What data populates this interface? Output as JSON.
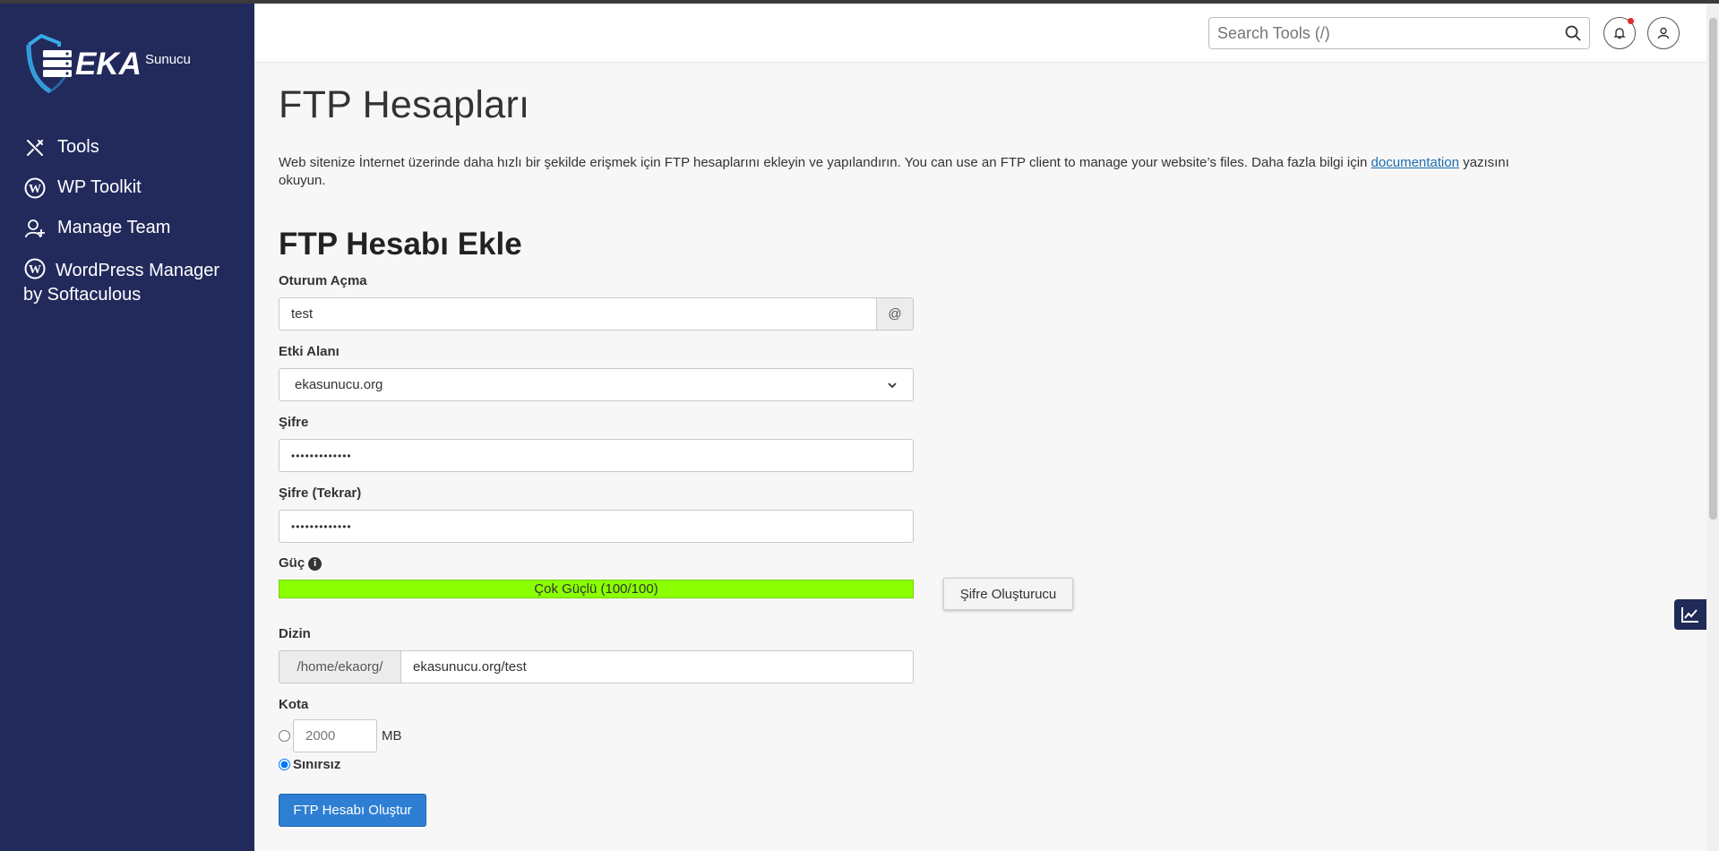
{
  "brand": {
    "name": "EKA",
    "suffix": "Sunucu"
  },
  "sidebar": {
    "items": [
      {
        "label": "Tools",
        "icon": "tools-icon"
      },
      {
        "label": "WP Toolkit",
        "icon": "wordpress-icon"
      },
      {
        "label": "Manage Team",
        "icon": "manage-team-icon"
      },
      {
        "label": "WordPress Manager by Softaculous",
        "icon": "wordpress-icon"
      }
    ]
  },
  "header": {
    "search_placeholder": "Search Tools (/)",
    "icons": [
      "search-icon",
      "bell-icon",
      "user-icon"
    ]
  },
  "main": {
    "title": "FTP Hesapları",
    "description": {
      "text": "Web sitenize İnternet üzerinde daha hızlı bir şekilde erişmek için FTP hesaplarını ekleyin ve yapılandırın. You can use an FTP client to manage your website’s files. Daha fazla bilgi için ",
      "link": "documentation",
      "text_after": " yazısını okuyun."
    },
    "section_title": "FTP Hesabı Ekle",
    "form": {
      "login_label": "Oturum Açma",
      "login_value": "test",
      "login_addon": "@",
      "domain_label": "Etki Alanı",
      "domain_value": "ekasunucu.org",
      "password_label": "Şifre",
      "password_value": "•••••••••••••",
      "password_repeat_label": "Şifre (Tekrar)",
      "password_repeat_value": "•••••••••••••",
      "strength_label": "Güç",
      "strength_text": "Çok Güçlü (100/100)",
      "strength_value": 100,
      "strength_color": "#8aff00",
      "generator_button": "Şifre Oluşturucu",
      "directory_label": "Dizin",
      "directory_prefix": "/home/ekaorg/",
      "directory_value": "ekasunucu.org/test",
      "quota_label": "Kota",
      "quota_value": "2000",
      "quota_unit": "MB",
      "unlimited_label": "Sınırsız",
      "unlimited_selected": true,
      "submit_button": "FTP Hesabı Oluştur"
    }
  },
  "colors": {
    "sidebar": "#222a5c",
    "accent": "#2e7fd3",
    "link": "#1e6db0"
  }
}
